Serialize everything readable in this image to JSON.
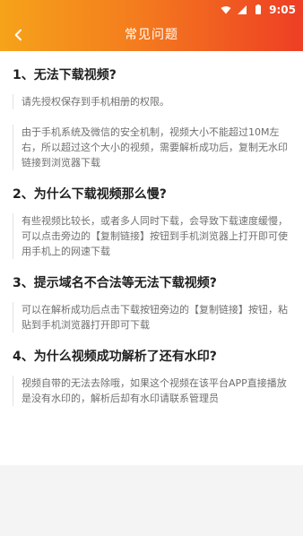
{
  "status_bar": {
    "time": "9:05"
  },
  "header": {
    "title": "常见问题"
  },
  "faq": [
    {
      "question": "1、无法下载视频?",
      "answers": [
        "请先授权保存到手机相册的权限。",
        "由于手机系统及微信的安全机制，视频大小不能超过10M左右，所以超过这个大小的视频，需要解析成功后，复制无水印链接到浏览器下载"
      ]
    },
    {
      "question": "2、为什么下载视频那么慢?",
      "answers": [
        "有些视频比较长，或者多人同时下载，会导致下载速度缓慢，可以点击旁边的【复制链接】按钮到手机浏览器上打开即可使用手机上的网速下载"
      ]
    },
    {
      "question": "3、提示域名不合法等无法下载视频?",
      "answers": [
        "可以在解析成功后点击下载按钮旁边的【复制链接】按钮，粘贴到手机浏览器打开即可下载"
      ]
    },
    {
      "question": "4、为什么视频成功解析了还有水印?",
      "answers": [
        "视频自带的无法去除哦，如果这个视频在该平台APP直接播放是没有水印的，解析后却有水印请联系管理员"
      ]
    }
  ],
  "icons": {
    "back": "chevron-left-icon",
    "wifi": "wifi-icon",
    "signal": "cellular-signal-icon",
    "battery": "battery-icon"
  },
  "colors": {
    "header_gradient_start": "#f6a31a",
    "header_gradient_end": "#ee3e24",
    "question_text": "#1f1f1f",
    "answer_text": "#6f6f6f"
  }
}
